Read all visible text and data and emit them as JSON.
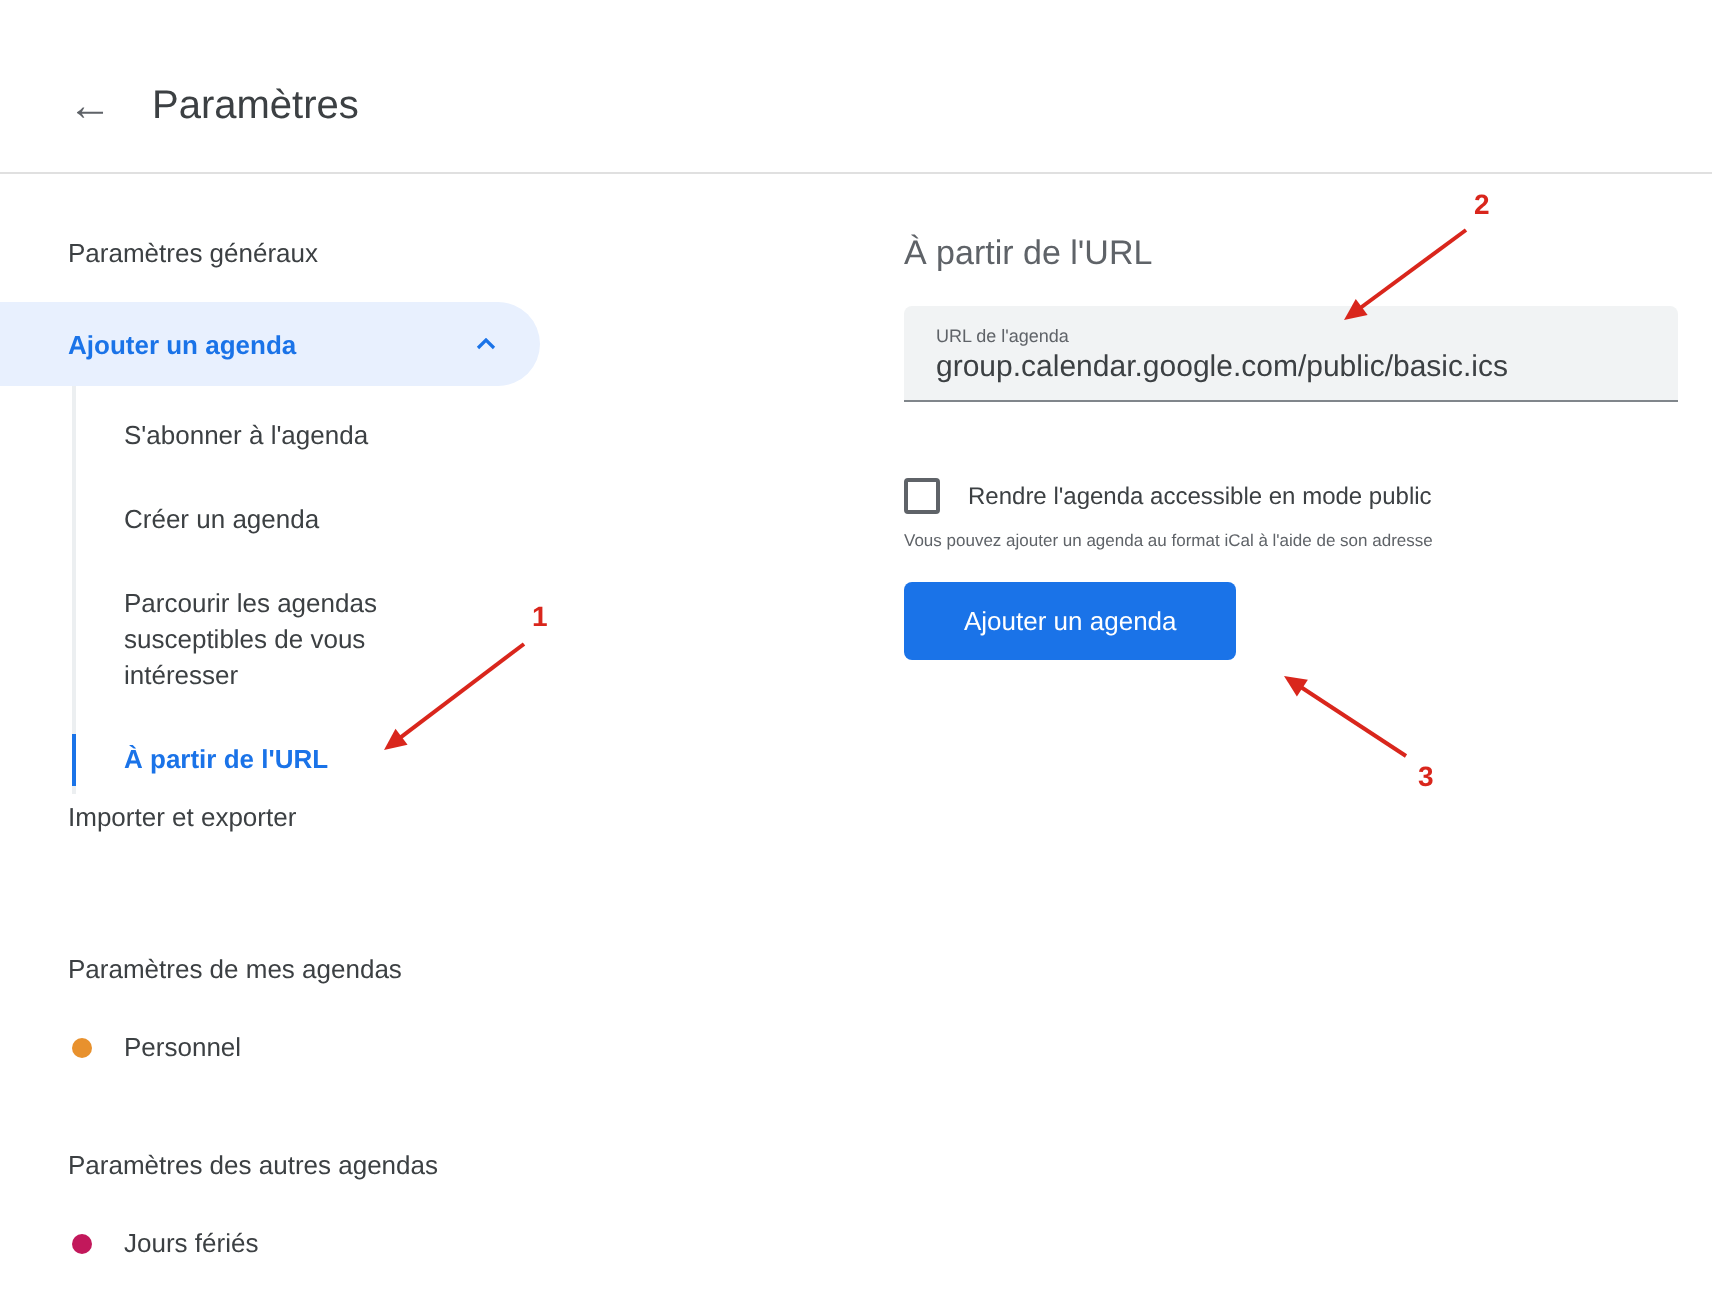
{
  "header": {
    "back": "←",
    "title": "Paramètres"
  },
  "sidebar": {
    "items": [
      {
        "kind": "link",
        "label": "Paramètres généraux",
        "selected": false
      },
      {
        "kind": "group",
        "label": "Ajouter un agenda",
        "expanded": true,
        "children": [
          {
            "label": "S'abonner à l'agenda",
            "selected": false
          },
          {
            "label": "Créer un agenda",
            "selected": false
          },
          {
            "label": "Parcourir les agendas susceptibles de vous intéresser",
            "selected": false
          },
          {
            "label": "À partir de l'URL",
            "selected": true
          }
        ]
      },
      {
        "kind": "link",
        "label": "Importer et exporter",
        "selected": false
      },
      {
        "kind": "heading",
        "label": "Paramètres de mes agendas"
      },
      {
        "kind": "calendar",
        "label": "Personnel",
        "color": "#e8912d"
      },
      {
        "kind": "heading",
        "label": "Paramètres des autres agendas"
      },
      {
        "kind": "calendar",
        "label": "Jours fériés",
        "color": "#c2185b"
      }
    ]
  },
  "content": {
    "title": "À partir de l'URL",
    "url_field": {
      "label": "URL de l'agenda",
      "value": "group.calendar.google.com/public/basic.ics"
    },
    "public_checkbox": {
      "label": "Rendre l'agenda accessible en mode public",
      "checked": false
    },
    "hint": "Vous pouvez ajouter un agenda au format iCal à l'aide de son adresse",
    "button": "Ajouter un agenda"
  },
  "annotations": [
    {
      "number": "1"
    },
    {
      "number": "2"
    },
    {
      "number": "3"
    }
  ]
}
